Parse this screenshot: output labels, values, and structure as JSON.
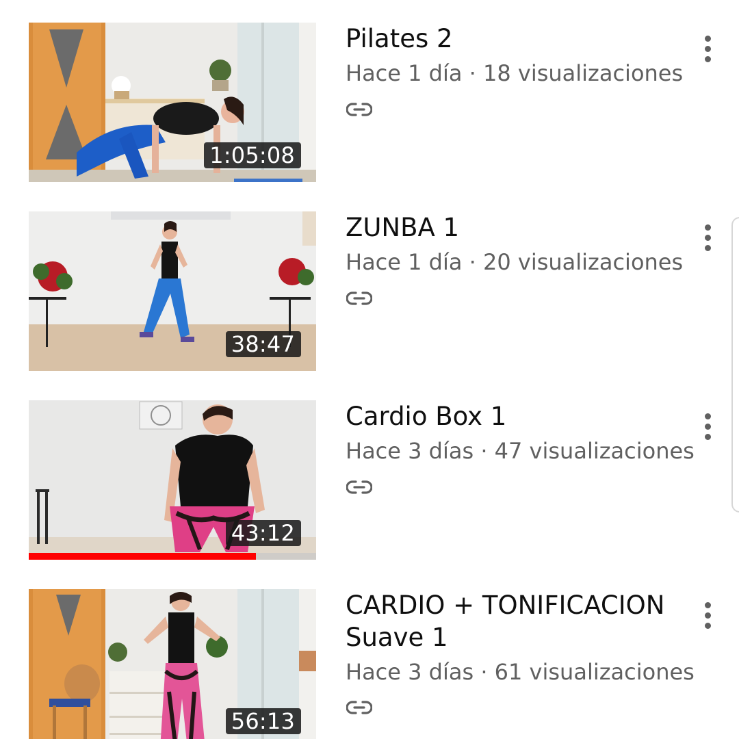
{
  "videos": [
    {
      "title": "Pilates 2",
      "meta": "Hace 1 día · 18 visualizaciones",
      "duration": "1:05:08",
      "visibility_icon": "link-icon",
      "watched_progress": null
    },
    {
      "title": "ZUNBA 1",
      "meta": "Hace 1 día · 20 visualizaciones",
      "duration": "38:47",
      "visibility_icon": "link-icon",
      "watched_progress": null
    },
    {
      "title": "Cardio Box 1",
      "meta": "Hace 3 días · 47 visualizaciones",
      "duration": "43:12",
      "visibility_icon": "link-icon",
      "watched_progress": 0.79
    },
    {
      "title": "CARDIO + TONIFICACION Suave 1",
      "meta": "Hace 3 días · 61 visualizaciones",
      "duration": "56:13",
      "visibility_icon": "link-icon",
      "watched_progress": null
    }
  ],
  "colors": {
    "progress": "#ff0000",
    "meta_text": "#606060",
    "title_text": "#0f0f0f",
    "duration_bg": "#191919"
  },
  "icons": {
    "overflow_menu": "more-vert-icon",
    "visibility": "link-icon"
  }
}
